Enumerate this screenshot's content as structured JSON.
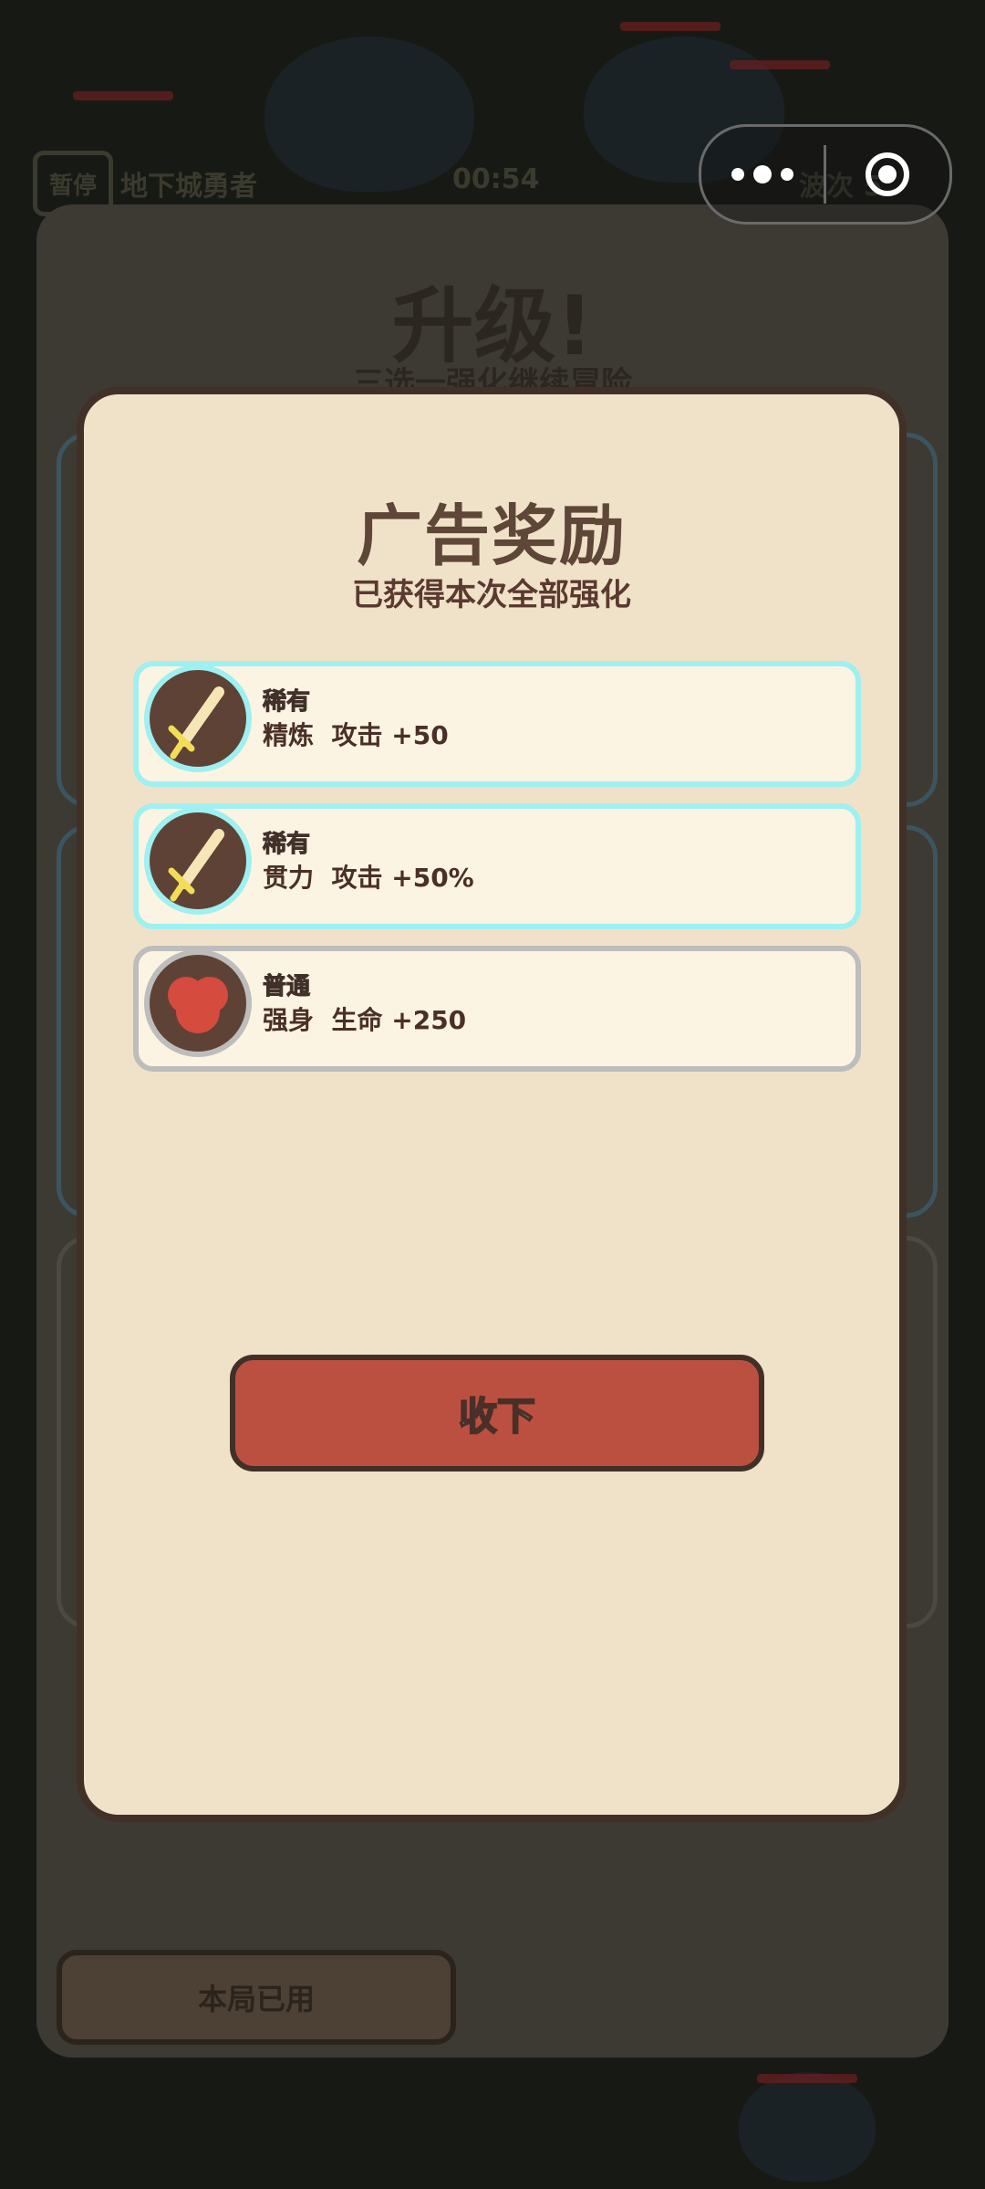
{
  "hud": {
    "pause_label": "暂停",
    "game_title": "地下城勇者",
    "timer": "00:54",
    "wave": "波次 5"
  },
  "levelup": {
    "title": "升级!",
    "subtitle": "三选一强化继续冒险",
    "used_label": "本局已用"
  },
  "modal": {
    "title": "广告奖励",
    "subtitle": "已获得本次全部强化",
    "rewards": [
      {
        "rarity": "稀有",
        "text": "精炼  攻击 +50",
        "icon": "sword-icon",
        "tier_color": "#9ff0f0"
      },
      {
        "rarity": "稀有",
        "text": "贯力  攻击 +50%",
        "icon": "sword-icon",
        "tier_color": "#9ff0f0"
      },
      {
        "rarity": "普通",
        "text": "强身  生命 +250",
        "icon": "heart-icon",
        "tier_color": "#bdbdbd"
      }
    ],
    "collect_label": "收下"
  }
}
